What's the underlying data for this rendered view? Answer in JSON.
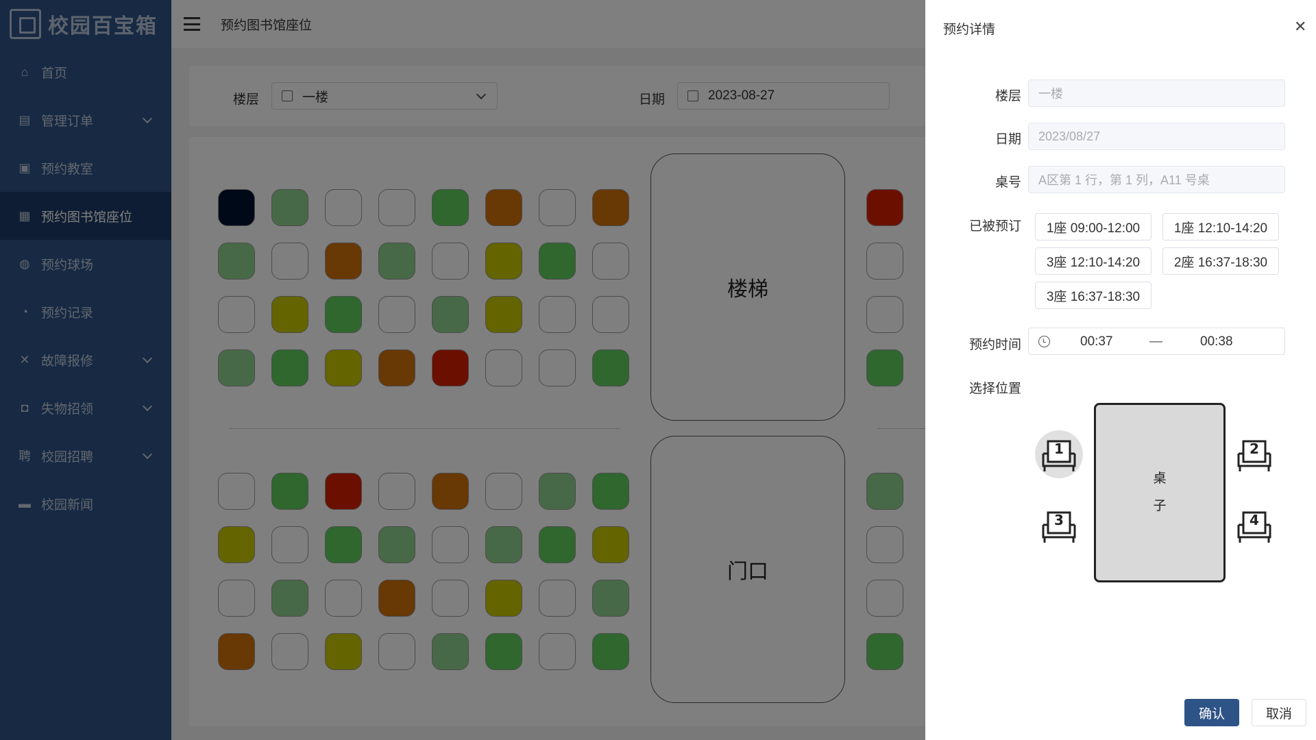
{
  "app": {
    "logo_text": "校园百宝箱"
  },
  "sidebar": {
    "items": [
      {
        "label": "首页",
        "icon": "home-icon"
      },
      {
        "label": "管理订单",
        "icon": "order-icon",
        "has_submenu": true
      },
      {
        "label": "预约教室",
        "icon": "classroom-icon"
      },
      {
        "label": "预约图书馆座位",
        "icon": "library-seat-icon",
        "active": true
      },
      {
        "label": "预约球场",
        "icon": "basketball-icon"
      },
      {
        "label": "预约记录",
        "icon": "clock-icon"
      },
      {
        "label": "故障报修",
        "icon": "tools-icon",
        "has_submenu": true
      },
      {
        "label": "失物招领",
        "icon": "lost-found-icon",
        "has_submenu": true
      },
      {
        "label": "校园招聘",
        "icon": "recruit-icon",
        "has_submenu": true
      },
      {
        "label": "校园新闻",
        "icon": "news-icon"
      }
    ]
  },
  "header": {
    "title": "预约图书馆座位"
  },
  "filter": {
    "floor_label": "楼层",
    "floor_value": "一楼",
    "date_label": "日期",
    "date_value": "2023-08-27"
  },
  "map": {
    "stairs_label": "楼梯",
    "door_label": "门口",
    "seat_colors": {
      "empty": "#ffffff",
      "light_green": "#8ed28e",
      "green": "#5fcf5f",
      "orange": "#d0700a",
      "olive": "#c8c800",
      "red": "#d71e00",
      "navy": "#001230"
    },
    "blocks": [
      {
        "rows": [
          [
            "navy",
            "light_green",
            "empty",
            "empty",
            "green",
            "orange",
            "empty",
            "orange"
          ],
          [
            "light_green",
            "empty",
            "orange",
            "light_green",
            "empty",
            "olive",
            "green",
            "empty"
          ],
          [
            "empty",
            "olive",
            "green",
            "empty",
            "light_green",
            "olive",
            "empty",
            "empty"
          ],
          [
            "light_green",
            "green",
            "olive",
            "orange",
            "red",
            "empty",
            "empty",
            "green"
          ]
        ]
      },
      {
        "rows": [
          [
            "empty",
            "green",
            "red",
            "empty",
            "orange",
            "empty",
            "light_green",
            "green"
          ],
          [
            "olive",
            "empty",
            "green",
            "light_green",
            "empty",
            "light_green",
            "green",
            "olive"
          ],
          [
            "empty",
            "light_green",
            "empty",
            "orange",
            "empty",
            "olive",
            "empty",
            "light_green"
          ],
          [
            "orange",
            "empty",
            "olive",
            "empty",
            "light_green",
            "green",
            "empty",
            "green"
          ]
        ]
      }
    ],
    "right_column": {
      "top": [
        "red",
        "empty",
        "empty",
        "green"
      ],
      "bottom": [
        "light_green",
        "empty",
        "empty",
        "green"
      ]
    }
  },
  "drawer": {
    "title": "预约详情",
    "floor_label": "楼层",
    "floor_value": "一楼",
    "date_label": "日期",
    "date_value": "2023/08/27",
    "desk_label": "桌号",
    "desk_value": "A区第 1 行，第 1 列，A11 号桌",
    "booked_label": "已被预订",
    "booked_slots": [
      "1座 09:00-12:00",
      "1座 12:10-14:20",
      "3座 12:10-14:20",
      "2座 16:37-18:30",
      "3座 16:37-18:30"
    ],
    "time_label": "预约时间",
    "time_start": "00:37",
    "time_sep": "—",
    "time_end": "00:38",
    "position_label": "选择位置",
    "desk_text_1": "桌",
    "desk_text_2": "子",
    "chairs": [
      "1",
      "2",
      "3",
      "4"
    ],
    "selected_chair": "1",
    "confirm_label": "确认",
    "cancel_label": "取消",
    "primary_color": "#2e5386"
  }
}
